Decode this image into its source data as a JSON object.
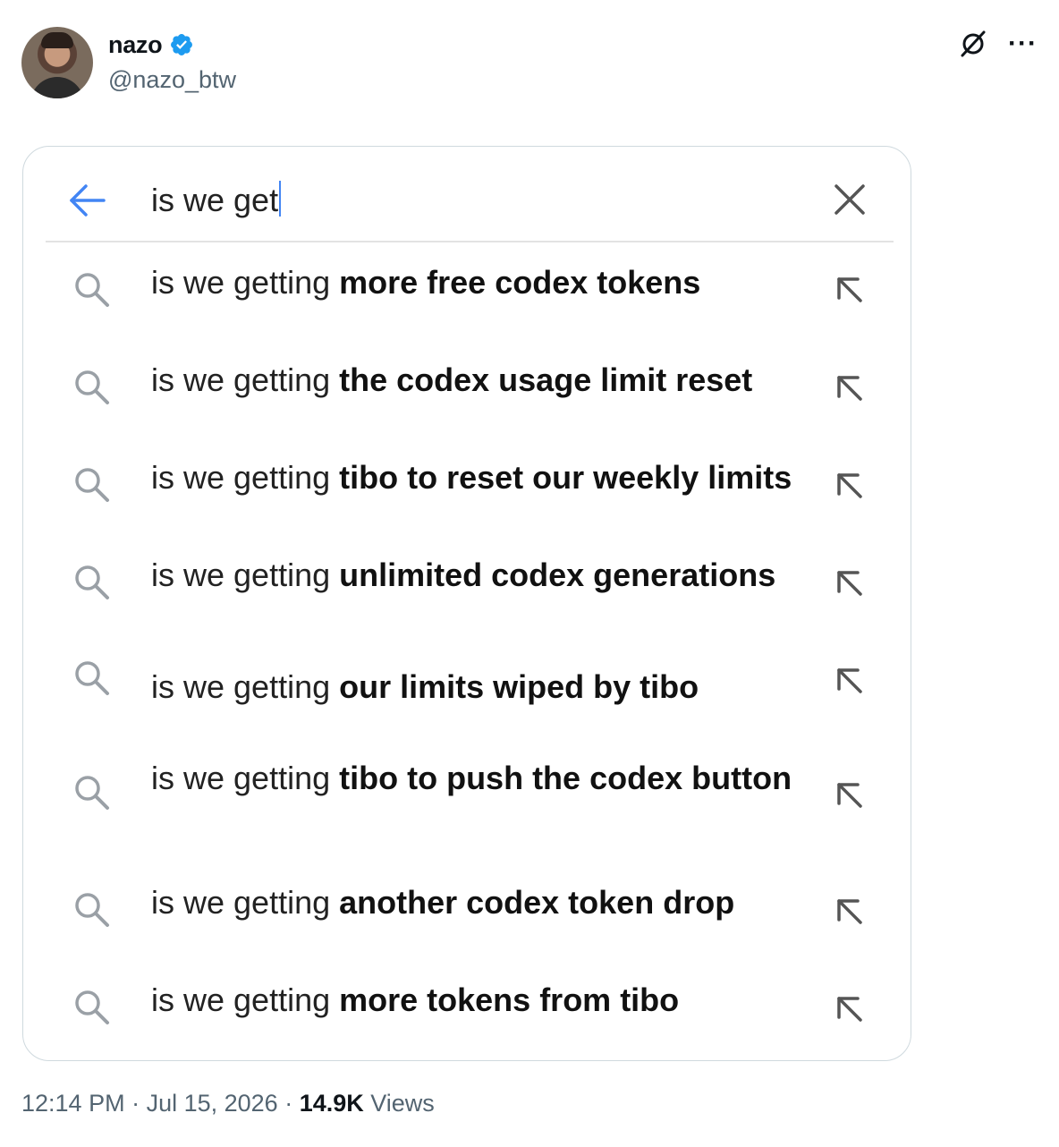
{
  "author": {
    "display_name": "nazo",
    "handle": "@nazo_btw"
  },
  "icons": {
    "verified": "verified-badge-icon",
    "grok": "grok-icon",
    "more": "more-icon",
    "back": "back-arrow-icon",
    "clear": "close-icon",
    "search": "search-icon",
    "fill": "arrow-up-left-icon"
  },
  "colors": {
    "verified_blue": "#1d9bf0",
    "back_arrow_blue": "#4285f4",
    "caret_blue": "#4285f4",
    "muted_text": "#536471"
  },
  "search": {
    "query": "is we get"
  },
  "suggestions": [
    {
      "prefix": "is we getting ",
      "rest": "more free codex tokens"
    },
    {
      "prefix": "is we getting ",
      "rest": "the codex usage limit reset"
    },
    {
      "prefix": "is we getting ",
      "rest": "tibo to reset our weekly limits"
    },
    {
      "prefix": "is we getting ",
      "rest": "unlimited codex generations"
    },
    {
      "prefix": "is we getting ",
      "rest": "our limits wiped by tibo"
    },
    {
      "prefix": "is we getting ",
      "rest": "tibo to push the codex button"
    },
    {
      "prefix": "is we getting ",
      "rest": "another codex token drop"
    },
    {
      "prefix": "is we getting ",
      "rest": "more tokens from tibo"
    }
  ],
  "footer": {
    "time": "12:14 PM",
    "separator": " · ",
    "date": "Jul 15, 2026",
    "views_count": "14.9K",
    "views_label": " Views"
  }
}
